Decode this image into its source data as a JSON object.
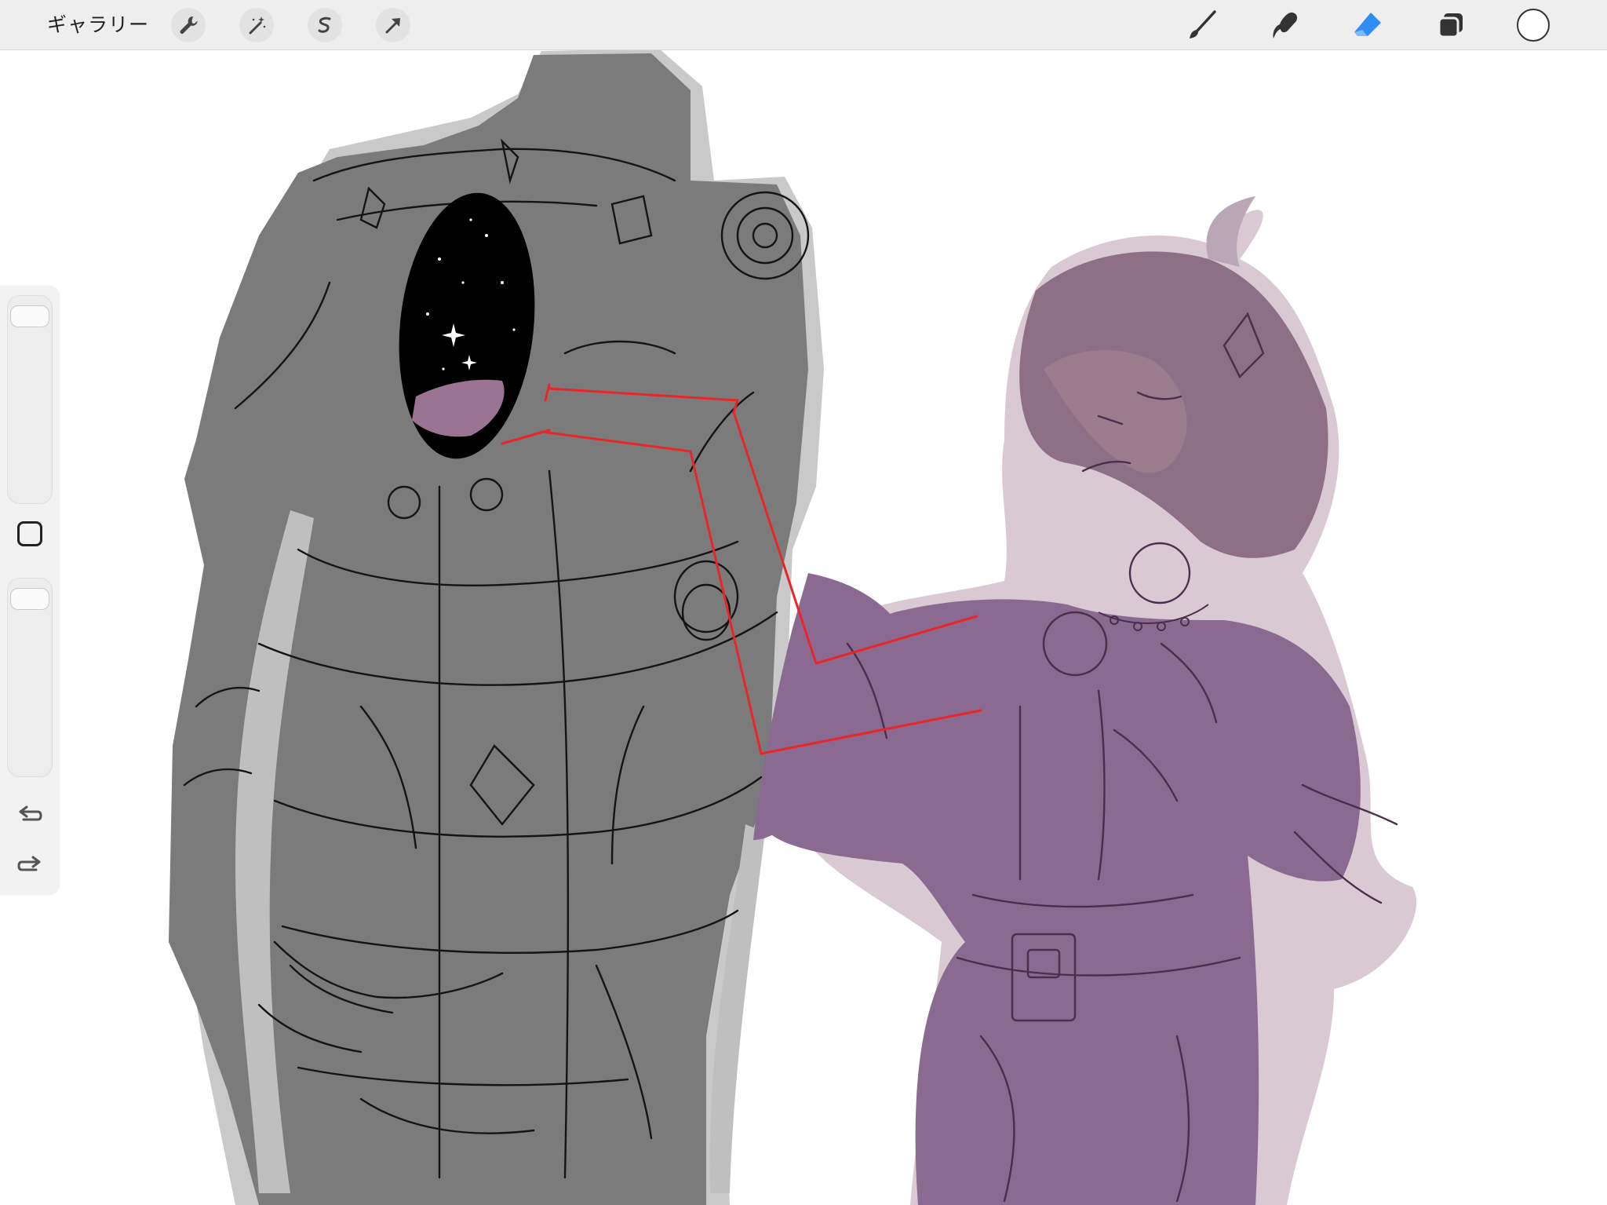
{
  "toolbar": {
    "gallery_label": "ギャラリー",
    "left_tools": [
      "wrench-icon",
      "magic-wand-icon",
      "selection-icon",
      "transform-arrow-icon"
    ],
    "right_tools": [
      "brush-icon",
      "smudge-icon",
      "eraser-icon",
      "layers-icon"
    ],
    "active_tool": "eraser",
    "active_color": "#2f8ef5",
    "current_color": "#ffffff"
  },
  "sidebar": {
    "brush_size_slider": "size",
    "opacity_slider": "opacity",
    "modify_button": "square-icon",
    "undo": "undo-icon",
    "redo": "redo-icon"
  },
  "canvas": {
    "figures": [
      "armored-figure",
      "girl-figure"
    ],
    "colors": {
      "armor_fill": "#7b7b7b",
      "armor_highlight": "#c9c9c9",
      "cosmos": "#000000",
      "girl_fill": "#8e7086",
      "girl_dress": "#8a6a90",
      "guide_line": "#e8262a"
    }
  }
}
